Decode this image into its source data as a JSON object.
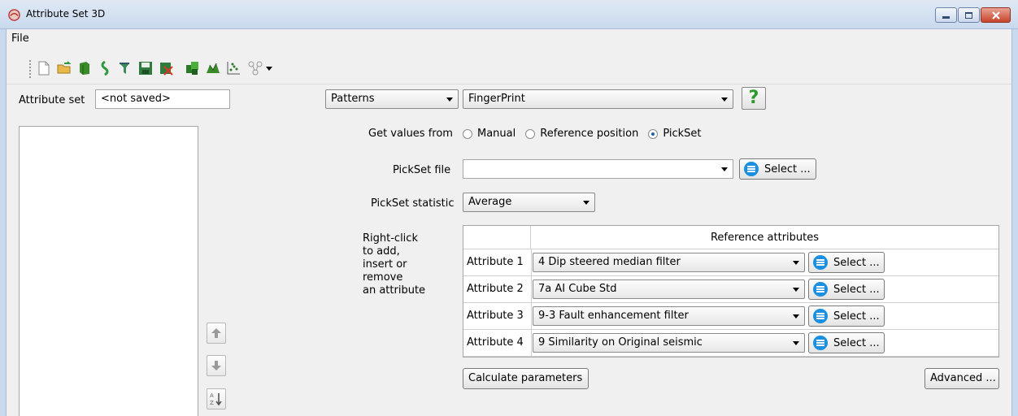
{
  "window": {
    "title": "Attribute Set 3D"
  },
  "menu": {
    "file": "File"
  },
  "toolbar": {
    "icons": [
      "new-file-icon",
      "open-folder-icon",
      "import-icon",
      "reload-icon",
      "save-as-icon",
      "save-icon",
      "clear-icon",
      "default-set-icon",
      "link-attributes-icon",
      "crossplot-icon",
      "graph-icon"
    ]
  },
  "attribute_set": {
    "label": "Attribute set",
    "value": "<not saved>"
  },
  "category_combo": {
    "value": "Patterns"
  },
  "type_combo": {
    "value": "FingerPrint"
  },
  "help_button": {
    "label": "?"
  },
  "get_values": {
    "label": "Get values from",
    "options": [
      "Manual",
      "Reference position",
      "PickSet"
    ],
    "selected": "PickSet"
  },
  "pickset_file": {
    "label": "PickSet file",
    "value": "",
    "select_label": "Select ..."
  },
  "pickset_statistic": {
    "label": "PickSet statistic",
    "value": "Average"
  },
  "hint": {
    "lines": [
      "Right-click",
      "to add,",
      "insert or",
      "remove",
      "an attribute"
    ]
  },
  "reference_table": {
    "header": "Reference attributes",
    "rows": [
      {
        "label": "Attribute 1",
        "value": "4 Dip steered median filter",
        "select_label": "Select ..."
      },
      {
        "label": "Attribute 2",
        "value": "7a AI Cube Std",
        "select_label": "Select ..."
      },
      {
        "label": "Attribute 3",
        "value": "9-3 Fault enhancement filter",
        "select_label": "Select ..."
      },
      {
        "label": "Attribute 4",
        "value": "9 Similarity on Original seismic",
        "select_label": "Select ..."
      }
    ]
  },
  "buttons": {
    "calculate": "Calculate parameters",
    "advanced": "Advanced ..."
  },
  "side_buttons": [
    "move-up-icon",
    "move-down-icon",
    "sort-az-icon"
  ],
  "colors": {
    "accent": "#1b8fe0",
    "titlebar": "#c9daee"
  }
}
